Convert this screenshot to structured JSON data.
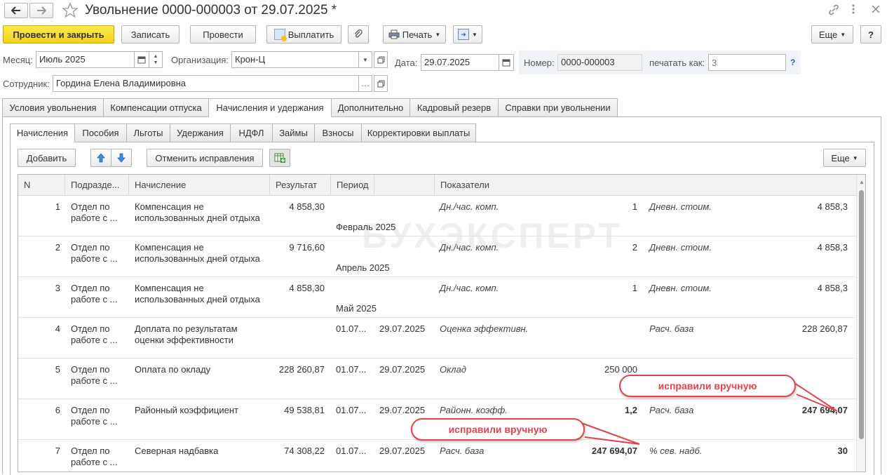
{
  "header": {
    "title": "Увольнение 0000-000003 от 29.07.2025 *"
  },
  "toolbar": {
    "post_close": "Провести и закрыть",
    "save": "Записать",
    "post": "Провести",
    "pay": "Выплатить",
    "print": "Печать",
    "more": "Еще",
    "help": "?"
  },
  "form": {
    "month_label": "Месяц:",
    "month_value": "Июль 2025",
    "org_label": "Организация:",
    "org_value": "Крон-Ц",
    "date_label": "Дата:",
    "date_value": "29.07.2025",
    "number_label": "Номер:",
    "number_value": "0000-000003",
    "print_as_label": "печатать как:",
    "print_as_placeholder": "3",
    "print_as_help": "?",
    "employee_label": "Сотрудник:",
    "employee_value": "Гордина Елена Владимировна"
  },
  "tabs": [
    "Условия увольнения",
    "Компенсации отпуска",
    "Начисления и удержания",
    "Дополнительно",
    "Кадровый резерв",
    "Справки при увольнении"
  ],
  "subtabs": [
    "Начисления",
    "Пособия",
    "Льготы",
    "Удержания",
    "НДФЛ",
    "Займы",
    "Взносы",
    "Корректировки выплаты"
  ],
  "grid_toolbar": {
    "add": "Добавить",
    "cancel_fix": "Отменить исправления",
    "more": "Еще"
  },
  "columns": [
    "N",
    "Подразде...",
    "Начисление",
    "Результат",
    "Период",
    "",
    "Показатели"
  ],
  "rows": [
    {
      "n": "1",
      "dept": [
        "Отдел по",
        "работе с ..."
      ],
      "accrual": [
        "Компенсация не",
        "использованных дней отдыха"
      ],
      "result": "4 858,30",
      "period": "Февраль 2025",
      "p_from": "",
      "p_to": "",
      "ind1": "Дн./час. комп.",
      "val1": "1",
      "ind2": "Дневн. стоим.",
      "val2": "4 858,3",
      "bold1": false,
      "bold2": false
    },
    {
      "n": "2",
      "dept": [
        "Отдел по",
        "работе с ..."
      ],
      "accrual": [
        "Компенсация не",
        "использованных дней отдыха"
      ],
      "result": "9 716,60",
      "period": "Апрель 2025",
      "p_from": "",
      "p_to": "",
      "ind1": "Дн./час. комп.",
      "val1": "2",
      "ind2": "Дневн. стоим.",
      "val2": "4 858,3",
      "bold1": false,
      "bold2": false
    },
    {
      "n": "3",
      "dept": [
        "Отдел по",
        "работе с ..."
      ],
      "accrual": [
        "Компенсация не",
        "использованных дней отдыха"
      ],
      "result": "4 858,30",
      "period": "Май 2025",
      "p_from": "",
      "p_to": "",
      "ind1": "Дн./час. комп.",
      "val1": "1",
      "ind2": "Дневн. стоим.",
      "val2": "4 858,3",
      "bold1": false,
      "bold2": false
    },
    {
      "n": "4",
      "dept": [
        "Отдел по",
        "работе с ..."
      ],
      "accrual": [
        "Доплата по результатам",
        "оценки эффективности"
      ],
      "result": "",
      "period": "",
      "p_from": "01.07...",
      "p_to": "29.07.2025",
      "ind1": "Оценка эффективн.",
      "val1": "",
      "ind2": "Расч. база",
      "val2": "228 260,87",
      "bold1": false,
      "bold2": false
    },
    {
      "n": "5",
      "dept": [
        "Отдел по",
        "работе с ..."
      ],
      "accrual": [
        "Оплата по окладу",
        ""
      ],
      "result": "228 260,87",
      "period": "",
      "p_from": "01.07...",
      "p_to": "29.07.2025",
      "ind1": "Оклад",
      "val1": "250 000",
      "ind2": "",
      "val2": "",
      "bold1": false,
      "bold2": false
    },
    {
      "n": "6",
      "dept": [
        "Отдел по",
        "работе с ..."
      ],
      "accrual": [
        "Районный коэффициент",
        ""
      ],
      "result": "49 538,81",
      "period": "",
      "p_from": "01.07...",
      "p_to": "29.07.2025",
      "ind1": "Районн. коэфф.",
      "val1": "1,2",
      "ind2": "Расч. база",
      "val2": "247 694,07",
      "bold1": true,
      "bold2": true
    },
    {
      "n": "7",
      "dept": [
        "Отдел по",
        "работе с ..."
      ],
      "accrual": [
        "Северная надбавка",
        ""
      ],
      "result": "74 308,22",
      "period": "",
      "p_from": "01.07...",
      "p_to": "29.07.2025",
      "ind1": "Расч. база",
      "val1": "247 694,07",
      "ind2": "% сев. надб.",
      "val2": "30",
      "bold1": true,
      "bold2": true
    }
  ],
  "callouts": [
    "исправили вручную",
    "исправили вручную"
  ],
  "watermark": "БУХЭКСПЕРТ",
  "colors": {
    "accent": "#f3d21b",
    "callout": "#e6424c"
  }
}
